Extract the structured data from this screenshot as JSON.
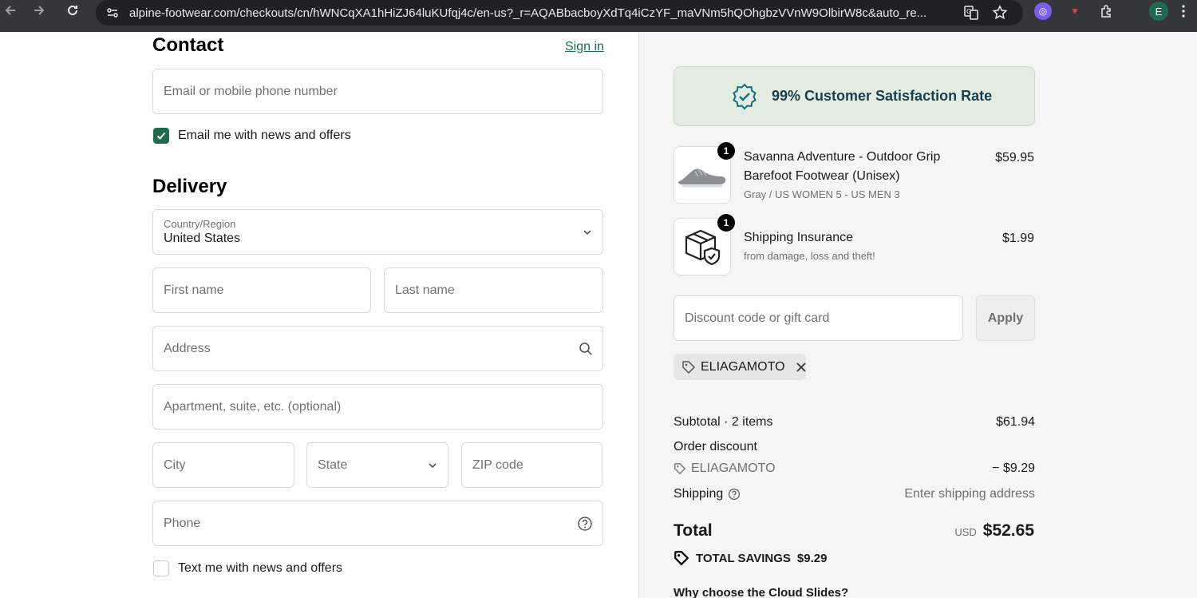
{
  "browser": {
    "url": "alpine-footwear.com/checkouts/cn/hWNCqXA1hHiZJ64luKUfqj4c/en-us?_r=AQABbacboyXdTq4iCzYF_maVNm5hQOhgbzVVnW9OlbirW8c&auto_re...",
    "profile_initial": "E"
  },
  "contact": {
    "heading": "Contact",
    "sign_in": "Sign in",
    "email_placeholder": "Email or mobile phone number",
    "news_label": "Email me with news and offers"
  },
  "delivery": {
    "heading": "Delivery",
    "country_label": "Country/Region",
    "country_value": "United States",
    "first_name": "First name",
    "last_name": "Last name",
    "address": "Address",
    "apartment": "Apartment, suite, etc. (optional)",
    "city": "City",
    "state": "State",
    "zip": "ZIP code",
    "phone": "Phone",
    "text_label": "Text me with news and offers"
  },
  "summary": {
    "banner": "99% Customer Satisfaction Rate",
    "items": [
      {
        "qty": "1",
        "title_line1": "Savanna Adventure - Outdoor Grip",
        "title_line2": "Barefoot Footwear (Unisex)",
        "variant": "Gray / US WOMEN 5 - US MEN 3",
        "price": "$59.95"
      },
      {
        "qty": "1",
        "title_line1": "Shipping Insurance",
        "variant": "from damage, loss and theft!",
        "price": "$1.99"
      }
    ],
    "discount_placeholder": "Discount code or gift card",
    "apply_label": "Apply",
    "applied_code": "ELIAGAMOTO",
    "subtotal_label": "Subtotal · 2 items",
    "subtotal_value": "$61.94",
    "order_discount_label": "Order discount",
    "discount_code": "ELIAGAMOTO",
    "discount_value": "− $9.29",
    "shipping_label": "Shipping",
    "shipping_value": "Enter shipping address",
    "total_label": "Total",
    "currency": "USD",
    "total_value": "$52.65",
    "savings_label": "TOTAL SAVINGS",
    "savings_value": "$9.29",
    "why_heading": "Why choose the Cloud Slides?"
  },
  "colors": {
    "accent": "#1e6b4b",
    "banner_bg": "#e3ece0",
    "banner_text": "#173f4d"
  }
}
